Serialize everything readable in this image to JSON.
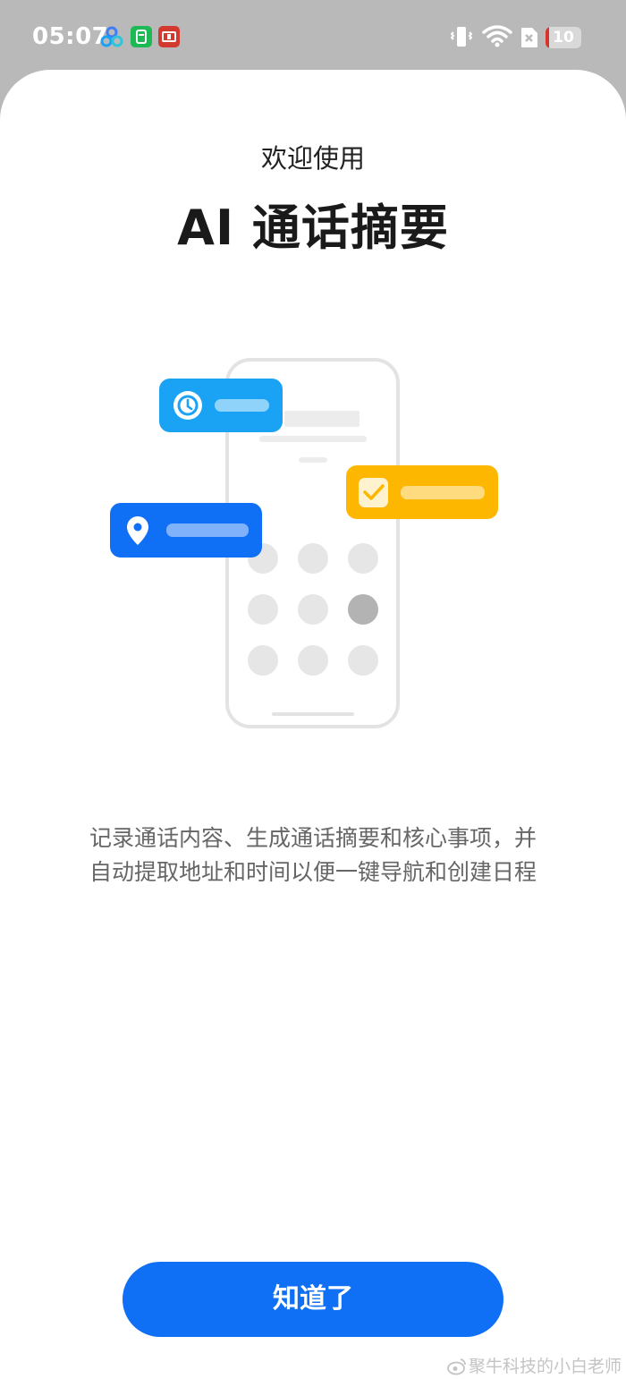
{
  "status_bar": {
    "time": "05:07",
    "battery_level": "10",
    "battery_fraction": 0.1,
    "app_icons": [
      "baidu-app-icon",
      "green-app-icon",
      "red-app-icon"
    ],
    "system_icons": [
      "vibrate-icon",
      "wifi-icon",
      "no-sim-icon",
      "battery-icon"
    ]
  },
  "welcome": {
    "subtitle": "欢迎使用",
    "title": "AI 通话摘要"
  },
  "illustration": {
    "cards": [
      "clock-icon",
      "location-pin-icon",
      "checkbox-icon"
    ],
    "colors": {
      "light_blue": "#1aa3f5",
      "blue": "#0f6ff5",
      "yellow": "#fdb700",
      "key_grey": "#e6e6e6",
      "key_dark": "#b3b3b3"
    }
  },
  "description": {
    "line1": "记录通话内容、生成通话摘要和核心事项，并",
    "line2": "自动提取地址和时间以便一键导航和创建日程"
  },
  "actions": {
    "confirm_label": "知道了"
  },
  "watermark": {
    "text": "聚牛科技的小白老师"
  },
  "colors": {
    "primary": "#0f6ff5",
    "statusbar_bg": "#b9b9b9",
    "battery_low": "#d8342c"
  }
}
